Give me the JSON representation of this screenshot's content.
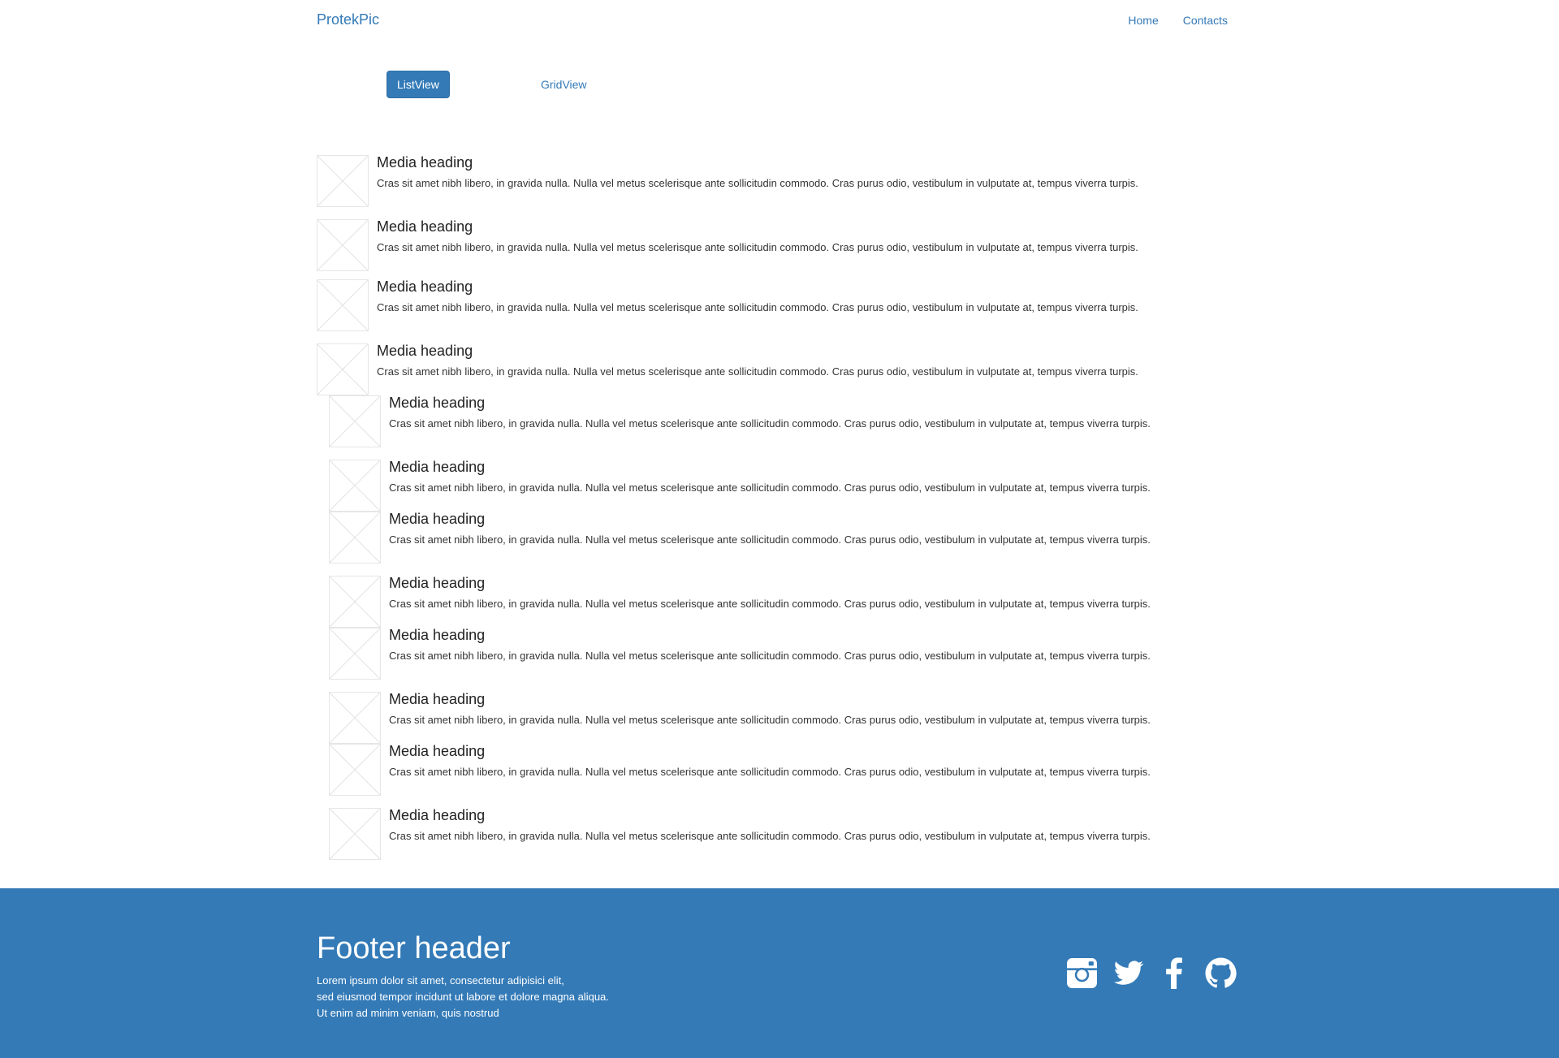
{
  "navbar": {
    "brand": "ProtekPic",
    "links": [
      "Home",
      "Contacts"
    ]
  },
  "view_toggle": {
    "list_label": "ListView",
    "grid_label": "GridView",
    "active": "ListView"
  },
  "media_items": [
    {
      "heading": "Media heading",
      "text": "Cras sit amet nibh libero, in gravida nulla. Nulla vel metus scelerisque ante sollicitudin commodo. Cras purus odio, vestibulum in vulputate at, tempus viverra turpis."
    },
    {
      "heading": "Media heading",
      "text": "Cras sit amet nibh libero, in gravida nulla. Nulla vel metus scelerisque ante sollicitudin commodo. Cras purus odio, vestibulum in vulputate at, tempus viverra turpis."
    },
    {
      "heading": "Media heading",
      "text": "Cras sit amet nibh libero, in gravida nulla. Nulla vel metus scelerisque ante sollicitudin commodo. Cras purus odio, vestibulum in vulputate at, tempus viverra turpis."
    },
    {
      "heading": "Media heading",
      "text": "Cras sit amet nibh libero, in gravida nulla. Nulla vel metus scelerisque ante sollicitudin commodo. Cras purus odio, vestibulum in vulputate at, tempus viverra turpis."
    },
    {
      "heading": "Media heading",
      "text": "Cras sit amet nibh libero, in gravida nulla. Nulla vel metus scelerisque ante sollicitudin commodo. Cras purus odio, vestibulum in vulputate at, tempus viverra turpis."
    },
    {
      "heading": "Media heading",
      "text": "Cras sit amet nibh libero, in gravida nulla. Nulla vel metus scelerisque ante sollicitudin commodo. Cras purus odio, vestibulum in vulputate at, tempus viverra turpis."
    },
    {
      "heading": "Media heading",
      "text": "Cras sit amet nibh libero, in gravida nulla. Nulla vel metus scelerisque ante sollicitudin commodo. Cras purus odio, vestibulum in vulputate at, tempus viverra turpis."
    },
    {
      "heading": "Media heading",
      "text": "Cras sit amet nibh libero, in gravida nulla. Nulla vel metus scelerisque ante sollicitudin commodo. Cras purus odio, vestibulum in vulputate at, tempus viverra turpis."
    },
    {
      "heading": "Media heading",
      "text": "Cras sit amet nibh libero, in gravida nulla. Nulla vel metus scelerisque ante sollicitudin commodo. Cras purus odio, vestibulum in vulputate at, tempus viverra turpis."
    },
    {
      "heading": "Media heading",
      "text": "Cras sit amet nibh libero, in gravida nulla. Nulla vel metus scelerisque ante sollicitudin commodo. Cras purus odio, vestibulum in vulputate at, tempus viverra turpis."
    },
    {
      "heading": "Media heading",
      "text": "Cras sit amet nibh libero, in gravida nulla. Nulla vel metus scelerisque ante sollicitudin commodo. Cras purus odio, vestibulum in vulputate at, tempus viverra turpis."
    },
    {
      "heading": "Media heading",
      "text": "Cras sit amet nibh libero, in gravida nulla. Nulla vel metus scelerisque ante sollicitudin commodo. Cras purus odio, vestibulum in vulputate at, tempus viverra turpis."
    }
  ],
  "footer": {
    "title": "Footer header",
    "lines": [
      "Lorem ipsum dolor sit amet, consectetur adipisici elit,",
      "sed eiusmod tempor incidunt ut labore et dolore magna aliqua.",
      "Ut enim ad minim veniam, quis nostrud"
    ],
    "social_icons": [
      "instagram-icon",
      "twitter-icon",
      "facebook-icon",
      "github-icon"
    ]
  },
  "colors": {
    "accent": "#337ab7",
    "footer_bg": "#337ab7",
    "text": "#222222",
    "thumb_border": "#e6e6e6"
  }
}
